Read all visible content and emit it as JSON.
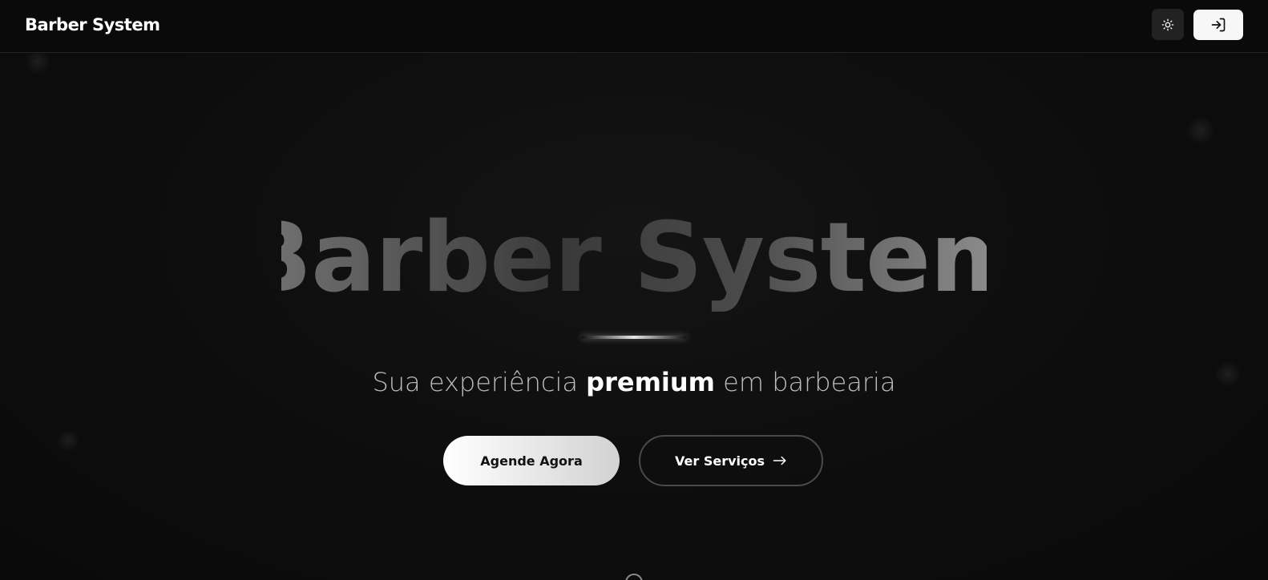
{
  "header": {
    "brand": "Barber System",
    "theme_icon": "sun-icon",
    "login_icon": "login-icon"
  },
  "hero": {
    "title": "Barber System",
    "tagline_before": "Sua experiência ",
    "tagline_strong": "premium",
    "tagline_after": " em barbearia",
    "primary_button": "Agende Agora",
    "secondary_button": "Ver Serviços",
    "secondary_icon": "arrow-right-icon"
  },
  "colors": {
    "background": "#0b0b0b",
    "text": "#ffffff",
    "muted": "#bdbdbd"
  }
}
